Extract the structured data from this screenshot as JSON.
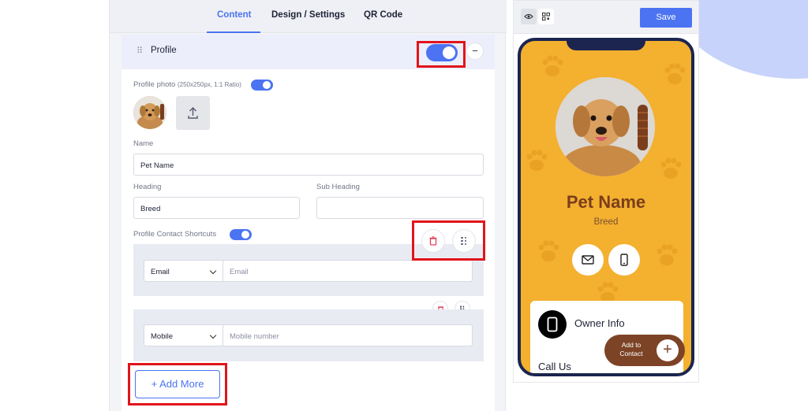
{
  "tabs": [
    {
      "label": "Content",
      "active": true
    },
    {
      "label": "Design / Settings",
      "active": false
    },
    {
      "label": "QR Code",
      "active": false
    }
  ],
  "profile": {
    "section_title": "Profile",
    "section_enabled": true,
    "collapse_symbol": "−",
    "photo_label": "Profile photo",
    "photo_hint": "(250x250px, 1:1 Ratio)",
    "photo_enabled": true,
    "name_label": "Name",
    "name_value": "Pet Name",
    "heading_label": "Heading",
    "heading_value": "Breed",
    "subheading_label": "Sub Heading",
    "subheading_value": "",
    "shortcuts_label": "Profile Contact Shortcuts",
    "shortcuts_enabled": true,
    "shortcuts": [
      {
        "type": "Email",
        "placeholder": "Email"
      },
      {
        "type": "Mobile",
        "placeholder": "Mobile number"
      }
    ],
    "add_more_label": "Add More",
    "add_more_symbol": "+"
  },
  "preview": {
    "save_label": "Save",
    "pet_name": "Pet Name",
    "breed": "Breed",
    "owner_info_title": "Owner Info",
    "call_us": "Call Us",
    "add_to_contact": "Add to Contact",
    "add_symbol": "+"
  },
  "colors": {
    "accent": "#4b73f2",
    "highlight": "#e1141b",
    "phone_bg": "#f4b02f",
    "pet_name": "#7a3e1c",
    "add_contact_bg": "#7d4326",
    "delete": "#e0405a"
  },
  "icons": [
    "drag-handle-icon",
    "upload-icon",
    "trash-icon",
    "grip-icon",
    "chevron-down-icon",
    "eye-icon",
    "qr-icon",
    "mail-icon",
    "mobile-icon",
    "plus-icon"
  ]
}
